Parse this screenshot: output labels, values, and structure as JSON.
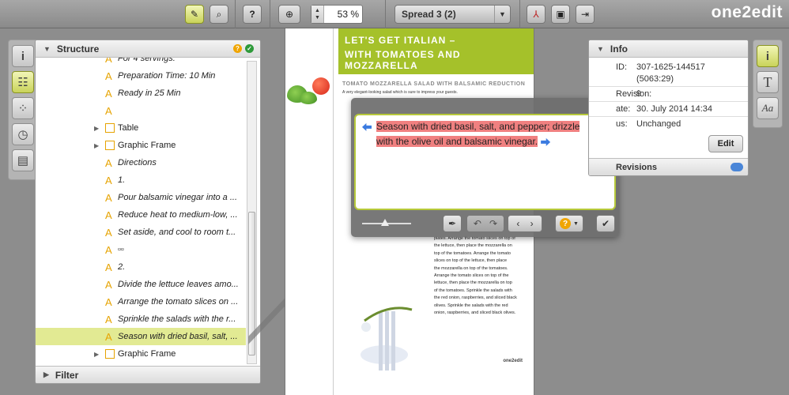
{
  "toolbar": {
    "zoom_value": "53 %",
    "spread_label": "Spread 3 (2)",
    "logo": "one2edit"
  },
  "structure_panel": {
    "title": "Structure",
    "filter_label": "Filter",
    "tree": [
      {
        "type": "text",
        "label": "For 4 servings:"
      },
      {
        "type": "text",
        "label": "Preparation Time: 10 Min"
      },
      {
        "type": "text",
        "label": "Ready in 25 Min"
      },
      {
        "type": "text",
        "label": ""
      },
      {
        "type": "frame",
        "label": "Table"
      },
      {
        "type": "frame",
        "label": "Graphic Frame"
      },
      {
        "type": "text",
        "label": "Directions"
      },
      {
        "type": "text",
        "label": "1."
      },
      {
        "type": "text",
        "label": "Pour balsamic vinegar into a ..."
      },
      {
        "type": "text",
        "label": "Reduce heat to medium-low, ..."
      },
      {
        "type": "text",
        "label": "Set aside, and cool to room t..."
      },
      {
        "type": "text",
        "label": "▫▫"
      },
      {
        "type": "text",
        "label": "2."
      },
      {
        "type": "text",
        "label": "Divide the lettuce leaves amo..."
      },
      {
        "type": "text",
        "label": "Arrange the tomato slices on ..."
      },
      {
        "type": "text",
        "label": "Sprinkle the salads with the r..."
      },
      {
        "type": "text",
        "label": "Season with dried basil, salt, ...",
        "selected": true
      },
      {
        "type": "frame",
        "label": "Graphic Frame"
      }
    ]
  },
  "document": {
    "header_line1": "LET'S GET ITALIAN –",
    "header_line2": "WITH TOMATOES AND MOZZARELLA",
    "recipe_title": "Tomato Mozzarella Salad with Balsamic Reduction",
    "recipe_sub": "A very elegant-looking salad which is sure to impress your guests.",
    "body_lines": [
      "plates. Arrange the tomato slices on top of",
      "the lettuce, then place the mozzarella on",
      "top of the tomatoes. Arrange the tomato",
      "slices on top of the lettuce, then place",
      "the mozzarella on top of the tomatoes.",
      "Arrange the tomato slices on top of the",
      "lettuce, then place the mozzarella on top",
      "of the tomatoes. Sprinkle the salads with",
      "the red onion, raspberries, and sliced black",
      "olives. Sprinkle the salads with the red",
      "onion, raspberries, and sliced black olives."
    ],
    "page_logo": "one2edit"
  },
  "editor": {
    "text_line1": "Season with dried basil, salt, and pepper; drizzle",
    "text_line2": "with the olive oil and balsamic vinegar."
  },
  "info_panel": {
    "title": "Info",
    "id_label": "ID:",
    "id_value": "307-1625-144517",
    "id_value2": "(5063:29)",
    "revision_label": "Revision:",
    "revision_value": "9",
    "date_label": "ate:",
    "date_value": "30. July 2014 14:34",
    "status_label": "us:",
    "status_value": "Unchanged",
    "edit_label": "Edit",
    "revisions_label": "Revisions"
  },
  "colors": {
    "accent_green": "#a5c12a",
    "highlight_red": "#f08080",
    "selection_yellow": "#e2ea93",
    "help_orange": "#f0a500",
    "ok_green": "#2e9a3a"
  }
}
